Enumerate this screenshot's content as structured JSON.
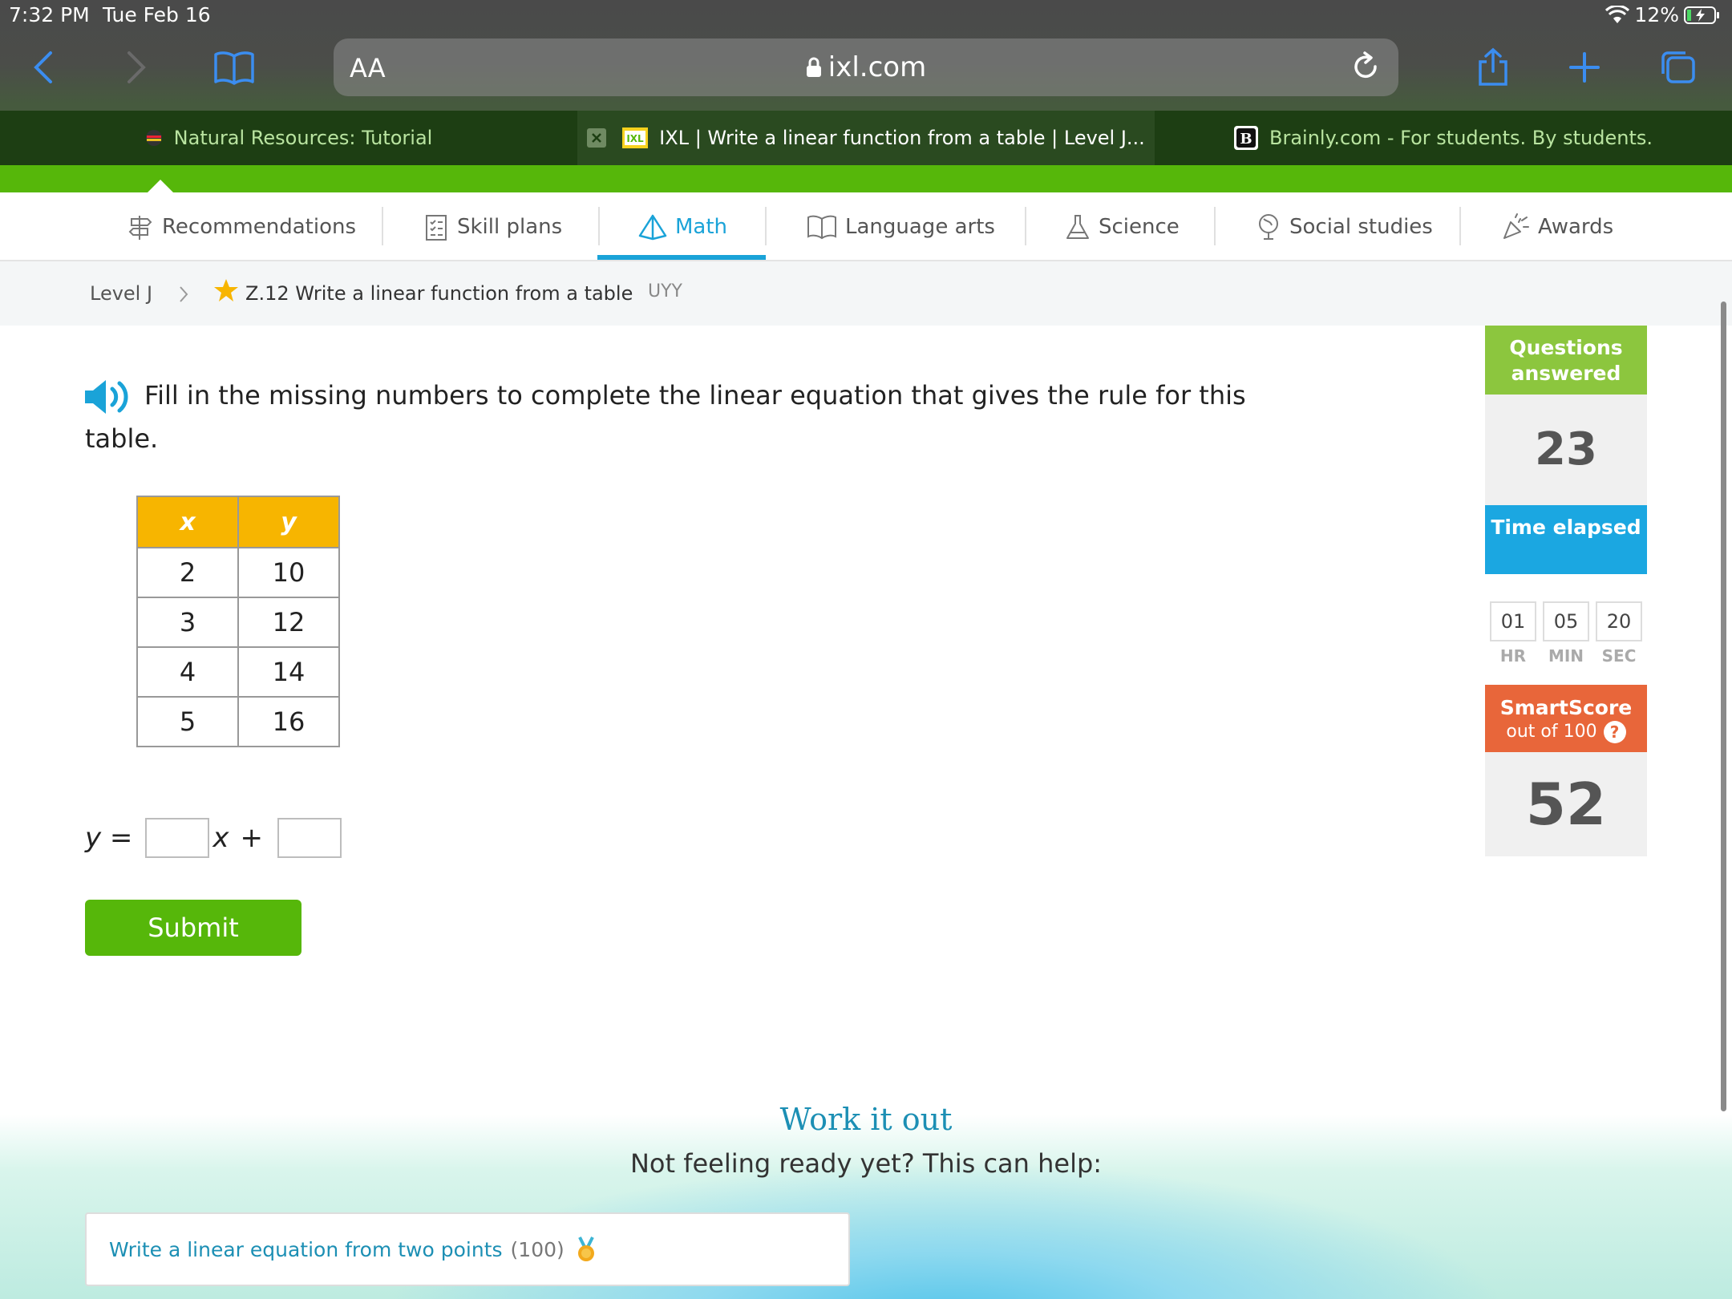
{
  "status": {
    "time": "7:32 PM",
    "date": "Tue Feb 16",
    "battery": "12%"
  },
  "browser": {
    "text_size": "AA",
    "url": "ixl.com",
    "tabs": [
      {
        "label": "Natural Resources: Tutorial"
      },
      {
        "label": "IXL | Write a linear function from a table | Level J..."
      },
      {
        "label": "Brainly.com - For students. By students."
      }
    ]
  },
  "nav": {
    "items": [
      {
        "label": "Recommendations"
      },
      {
        "label": "Skill plans"
      },
      {
        "label": "Math"
      },
      {
        "label": "Language arts"
      },
      {
        "label": "Science"
      },
      {
        "label": "Social studies"
      },
      {
        "label": "Awards"
      }
    ]
  },
  "breadcrumb": {
    "level": "Level J",
    "skill": "Z.12 Write a linear function from a table",
    "code": "UYY"
  },
  "question": {
    "prompt": "Fill in the missing numbers to complete the linear equation that gives the rule for this table.",
    "table": {
      "headers": [
        "x",
        "y"
      ],
      "rows": [
        [
          "2",
          "10"
        ],
        [
          "3",
          "12"
        ],
        [
          "4",
          "14"
        ],
        [
          "5",
          "16"
        ]
      ]
    },
    "equation": {
      "lhs": "y =",
      "var": "x",
      "plus": "+"
    },
    "submit_label": "Submit"
  },
  "sidebar": {
    "questions_title": "Questions answered",
    "questions_count": "23",
    "time_title": "Time elapsed",
    "time": {
      "hr": "01",
      "min": "05",
      "sec": "20",
      "hr_label": "HR",
      "min_label": "MIN",
      "sec_label": "SEC"
    },
    "smartscore_title": "SmartScore",
    "smartscore_sub": "out of 100",
    "smartscore_value": "52"
  },
  "help": {
    "title": "Work it out",
    "subtitle": "Not feeling ready yet? This can help:",
    "link_label": "Write a linear equation from two points",
    "link_score": "(100)"
  },
  "colors": {
    "ixl_green": "#56b70a",
    "math_blue": "#1aa3d8",
    "table_header": "#f7b500",
    "smartscore": "#e8663a"
  }
}
